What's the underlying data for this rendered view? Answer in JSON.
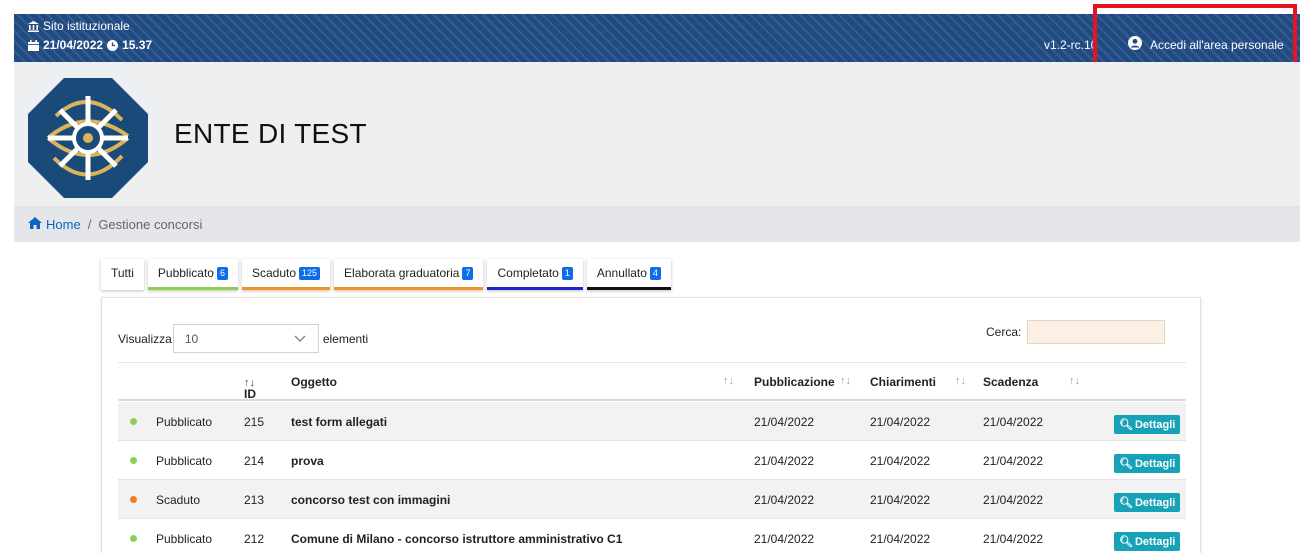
{
  "topbar": {
    "site_label": "Sito istituzionale",
    "date": "21/04/2022",
    "time": "15.37",
    "version": "v1.2-rc.10",
    "login_label": "Accedi all'area personale",
    "icons": [
      "bank-icon",
      "calendar-icon",
      "clock-icon",
      "user-circle-icon"
    ]
  },
  "header": {
    "entity_name": "ENTE DI TEST"
  },
  "breadcrumb": {
    "home": "Home",
    "separator": "/",
    "current": "Gestione concorsi"
  },
  "tabs": [
    {
      "label": "Tutti",
      "badge": "",
      "color": ""
    },
    {
      "label": "Pubblicato",
      "badge": "6",
      "color": "#8bd04f"
    },
    {
      "label": "Scaduto",
      "badge": "125",
      "color": "#f0932b"
    },
    {
      "label": "Elaborata graduatoria",
      "badge": "7",
      "color": "#f0932b"
    },
    {
      "label": "Completato",
      "badge": "1",
      "color": "#1b28cc"
    },
    {
      "label": "Annullato",
      "badge": "4",
      "color": "#111111"
    }
  ],
  "table": {
    "show_label": "Visualizza",
    "page_size": "10",
    "after_label": "elementi",
    "search_label": "Cerca:",
    "search_value": "",
    "columns": {
      "id": "ID",
      "object": "Oggetto",
      "publication": "Pubblicazione",
      "clarifications": "Chiarimenti",
      "deadline": "Scadenza"
    },
    "button_label": "Dettagli",
    "rows": [
      {
        "status": "Pubblicato",
        "status_color": "#8bd04f",
        "id": "215",
        "object": "test form allegati",
        "publication": "21/04/2022",
        "clarifications": "21/04/2022",
        "deadline": "21/04/2022"
      },
      {
        "status": "Pubblicato",
        "status_color": "#8bd04f",
        "id": "214",
        "object": "prova",
        "publication": "21/04/2022",
        "clarifications": "21/04/2022",
        "deadline": "21/04/2022"
      },
      {
        "status": "Scaduto",
        "status_color": "#f07c1e",
        "id": "213",
        "object": "concorso test con immagini",
        "publication": "21/04/2022",
        "clarifications": "21/04/2022",
        "deadline": "21/04/2022"
      },
      {
        "status": "Pubblicato",
        "status_color": "#8bd04f",
        "id": "212",
        "object": "Comune di Milano - concorso istruttore amministrativo C1",
        "publication": "21/04/2022",
        "clarifications": "21/04/2022",
        "deadline": "21/04/2022"
      }
    ]
  },
  "colors": {
    "topbar": "#1f4a82",
    "link": "#0b66c3",
    "button": "#17a2b8",
    "highlight": "#e6141e"
  }
}
